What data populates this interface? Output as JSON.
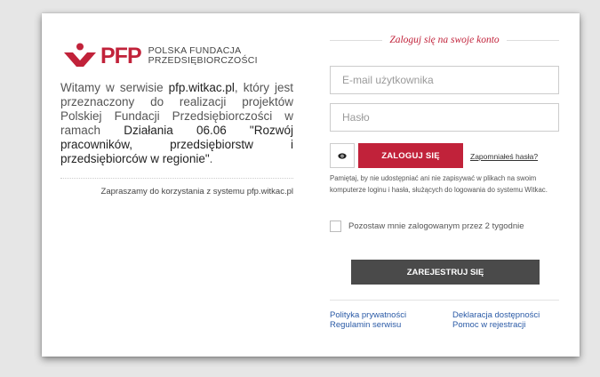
{
  "brand": {
    "acronym": "PFP",
    "name_line1": "POLSKA FUNDACJA",
    "name_line2": "PRZEDSIĘBIORCZOŚCI",
    "color": "#c1223a"
  },
  "intro": {
    "t1": "Witamy w serwisie ",
    "site": "pfp.witkac.pl",
    "t2": ", który jest przeznaczony do realizacji projektów Polskiej Fundacji Przedsiębiorczości w ramach ",
    "action": "Działania 06.06 \"Rozwój pracowników, przedsiębiorstw i przedsiębiorców w regionie\"",
    "t3": "."
  },
  "welcome": "Zapraszamy do korzystania z systemu pfp.witkac.pl",
  "login": {
    "heading": "Zaloguj się na swoje konto",
    "email_placeholder": "E-mail użytkownika",
    "password_placeholder": "Hasło",
    "show_password_icon": "eye-icon",
    "login_button": "ZALOGUJ SIĘ",
    "forgot_link": "Zapomniałeś hasła?",
    "notice": "Pamiętaj, by nie udostępniać ani nie zapisywać w plikach na swoim komputerze loginu i hasła, służących do logowania do systemu Witkac.",
    "remember_label": "Pozostaw mnie zalogowanym przez 2 tygodnie",
    "register_button": "ZAREJESTRUJ SIĘ"
  },
  "footer_links": {
    "privacy": "Polityka prywatności",
    "terms": "Regulamin serwisu",
    "accessibility": "Deklaracja dostępności",
    "registration_help": "Pomoc w rejestracji"
  },
  "colors": {
    "accent": "#c1223a",
    "dark_button": "#4a4a4a",
    "link": "#2a5aa6"
  }
}
